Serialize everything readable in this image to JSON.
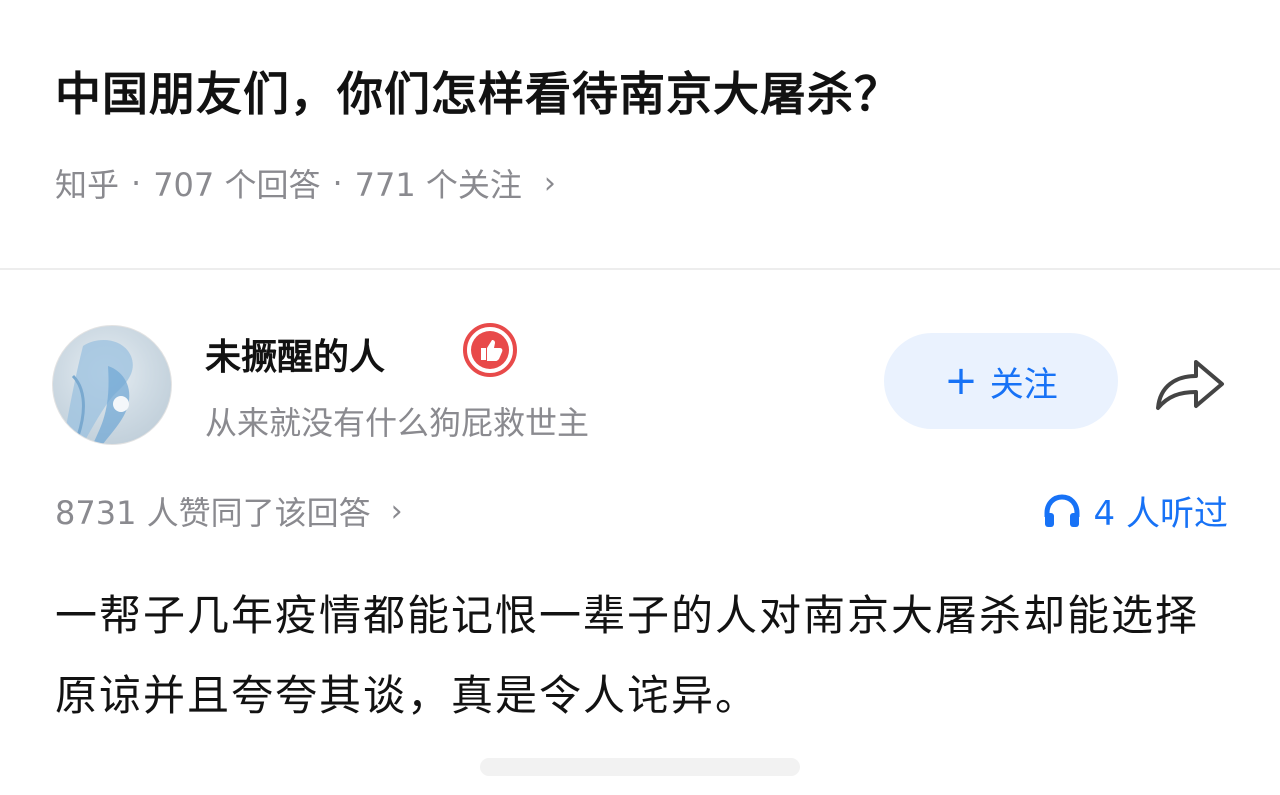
{
  "question": {
    "title": "中国朋友们，你们怎样看待南京大屠杀？",
    "meta": {
      "source": "知乎",
      "answers": "707 个回答",
      "followers": "771 个关注",
      "separator": "·",
      "chevron": "›"
    }
  },
  "answer": {
    "author": {
      "name": "未撅醒的人",
      "bio": "从来就没有什么狗屁救世主",
      "badge_icon": "thumbs-up-badge-icon"
    },
    "follow_button": {
      "plus": "+",
      "label": "关注"
    },
    "share_icon": "share-arrow-icon",
    "votes": {
      "text": "8731 人赞同了该回答",
      "chevron": "›"
    },
    "listen": {
      "icon": "headphones-icon",
      "text": "4 人听过"
    },
    "content": "一帮子几年疫情都能记恨一辈子的人对南京大屠杀却能选择原谅并且夸夸其谈，真是令人诧异。"
  },
  "colors": {
    "accent": "#1772f6",
    "follow_bg": "#eaf2fe",
    "muted_text": "#8a8a8f",
    "badge_red": "#e84a4a"
  }
}
